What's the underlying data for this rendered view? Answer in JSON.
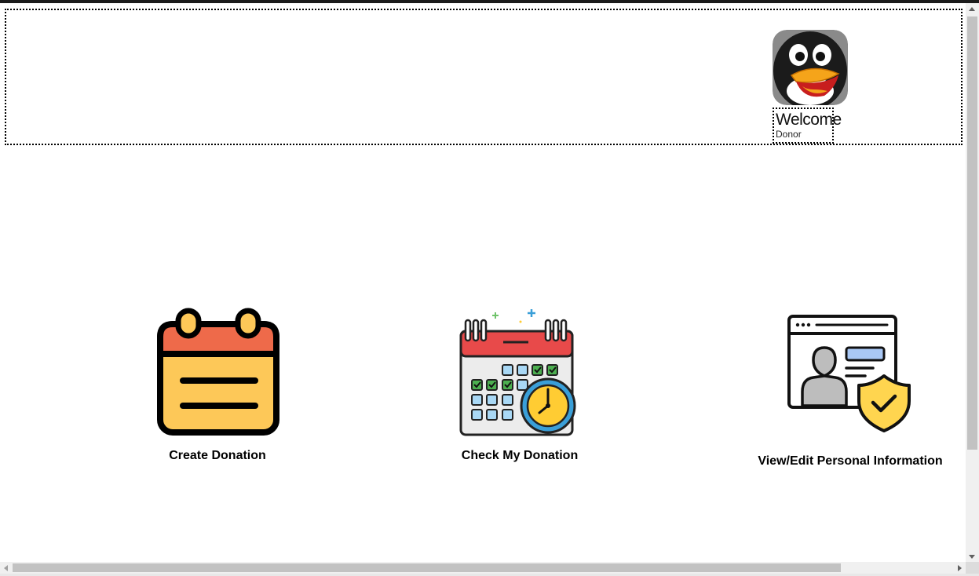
{
  "header": {
    "welcome_text": "Welcome",
    "role_text": "Donor",
    "avatar_icon": "penguin-avatar-icon"
  },
  "tiles": [
    {
      "label": "Create Donation",
      "icon": "notepad-icon"
    },
    {
      "label": "Check My Donation",
      "icon": "calendar-clock-icon"
    },
    {
      "label": "View/Edit Personal Information",
      "icon": "profile-shield-icon"
    }
  ],
  "colors": {
    "notepad_top": "#EE6A4A",
    "notepad_body": "#FDC858",
    "calendar_top": "#E84A4A",
    "calendar_cell": "#A9D8F5",
    "calendar_check": "#4CAF50",
    "clock_face": "#FFCC33",
    "clock_ring": "#3A9FD8",
    "shield": "#FFD54F",
    "profile_field": "#A9C8F5"
  }
}
